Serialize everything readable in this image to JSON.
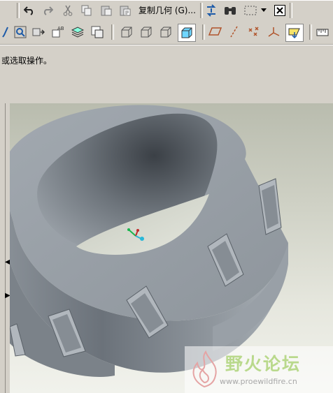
{
  "toolbar_top": {
    "copy_geometry_label": "复制几何 (G)...",
    "icons": [
      "undo-icon",
      "redo-icon",
      "cut-icon",
      "copy-icon",
      "paste-icon",
      "paste-special-icon",
      "regenerate-icon",
      "find-icon",
      "select-box-icon",
      "dropdown-icon",
      "close-icon"
    ]
  },
  "toolbar_view": {
    "icons": [
      "repaint-icon",
      "zoom-window-icon",
      "reorient-icon",
      "saved-views-icon",
      "layers-icon",
      "model-tree-icon",
      "wireframe-icon",
      "hidden-line-icon",
      "no-hidden-icon",
      "shaded-icon",
      "datum-plane-icon",
      "datum-axis-icon",
      "datum-point-icon",
      "coordinate-system-icon",
      "spin-center-icon",
      "measure-icon"
    ]
  },
  "message": {
    "text": "或选取操作。"
  },
  "watermark": {
    "title": "野火论坛",
    "url": "www.proewildfire.cn"
  },
  "colors": {
    "part_base": "#9aa1a8",
    "part_dark": "#5d646b",
    "background_top": "#b9bcae",
    "background_bottom": "#f1f2ec"
  }
}
